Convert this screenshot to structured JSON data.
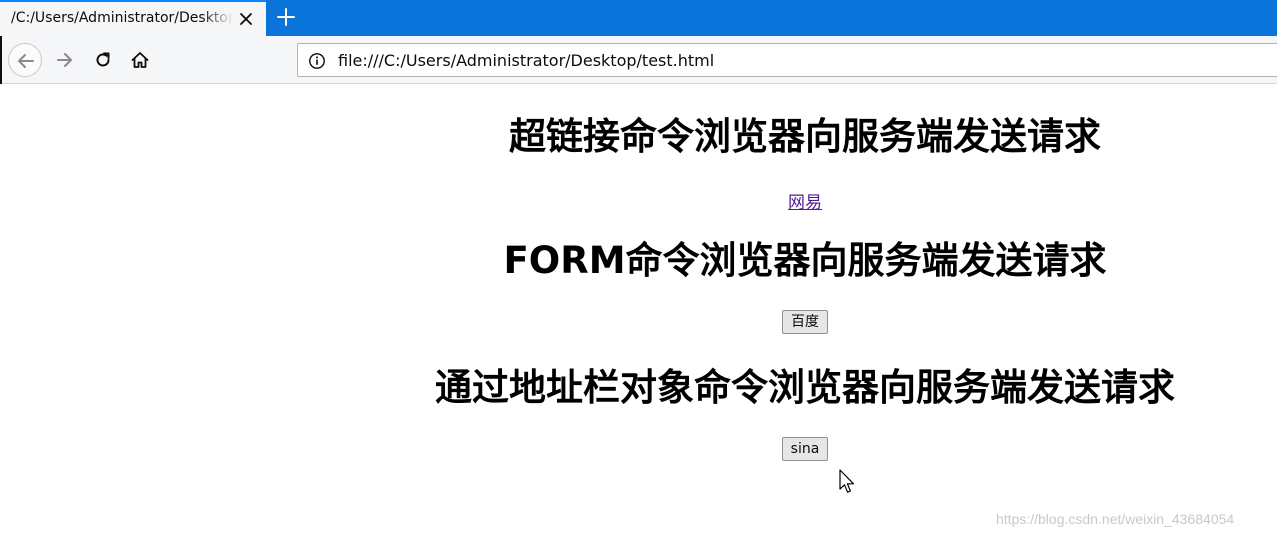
{
  "browser": {
    "tab": {
      "title": "/C:/Users/Administrator/Desktop/test.html",
      "close_icon": "close-icon"
    },
    "new_tab_icon": "plus-icon",
    "toolbar": {
      "back_icon": "arrow-left-icon",
      "forward_icon": "arrow-right-icon",
      "reload_icon": "reload-icon",
      "home_icon": "home-icon"
    },
    "urlbar": {
      "info_icon": "info-icon",
      "url": "file:///C:/Users/Administrator/Desktop/test.html"
    },
    "accent_color": "#0a74da"
  },
  "page": {
    "heading_link": "超链接命令浏览器向服务端发送请求",
    "link_text": "网易",
    "heading_form": "FORM命令浏览器向服务端发送请求",
    "form_button": "百度",
    "heading_location": "通过地址栏对象命令浏览器向服务端发送请求",
    "location_button": "sina"
  },
  "watermark": "https://blog.csdn.net/weixin_43684054"
}
